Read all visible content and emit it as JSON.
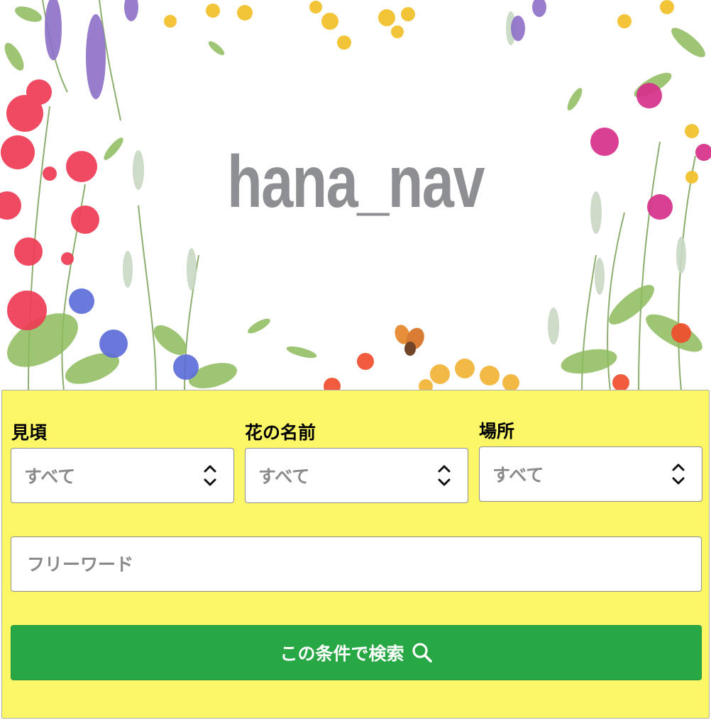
{
  "header": {
    "logo_text": "hana_nav"
  },
  "search": {
    "fields": [
      {
        "label": "見頃",
        "selected": "すべて"
      },
      {
        "label": "花の名前",
        "selected": "すべて"
      },
      {
        "label": "場所",
        "selected": "すべて"
      }
    ],
    "freeword_placeholder": "フリーワード",
    "submit_label": "この条件で検索"
  },
  "colors": {
    "panel_bg": "#fbf766",
    "button_bg": "#28a745",
    "logo": "#8d8f92"
  },
  "icons": {
    "select_arrows": "chevron-up-down-icon",
    "submit": "search-icon"
  }
}
